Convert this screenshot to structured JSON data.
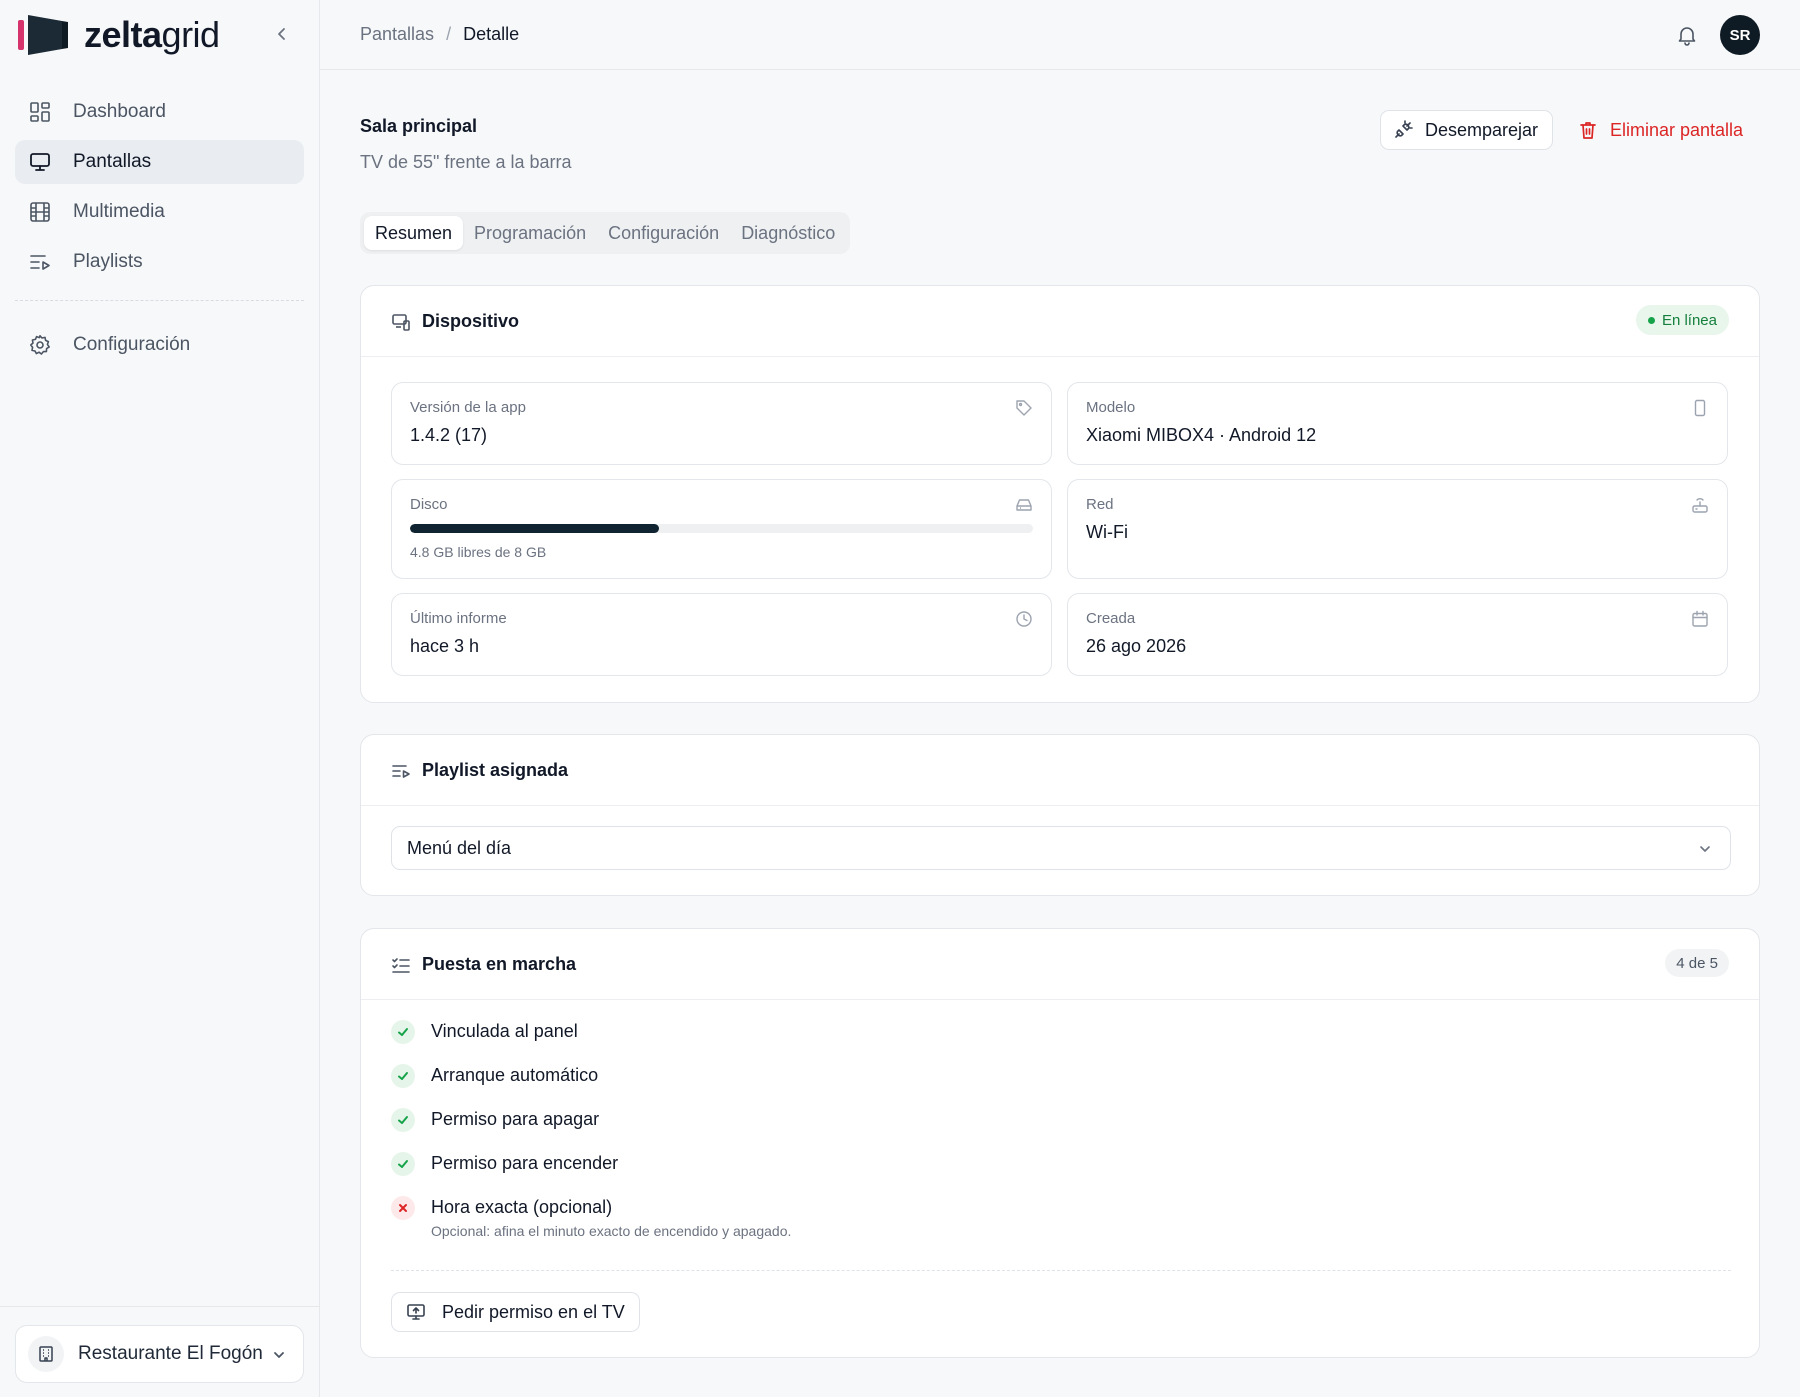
{
  "brand": {
    "name_bold": "zelta",
    "name_light": "grid",
    "accent_color": "#d6336c",
    "logo_color": "#1b2a35"
  },
  "sidebar": {
    "items": [
      {
        "label": "Dashboard",
        "icon": "dashboard-icon"
      },
      {
        "label": "Pantallas",
        "icon": "monitor-icon",
        "active": true
      },
      {
        "label": "Multimedia",
        "icon": "film-icon"
      },
      {
        "label": "Playlists",
        "icon": "playlist-icon"
      }
    ],
    "settings_label": "Configuración",
    "org_name": "Restaurante El Fogón"
  },
  "header": {
    "breadcrumb_parent": "Pantallas",
    "breadcrumb_separator": "/",
    "breadcrumb_current": "Detalle",
    "avatar_initials": "SR"
  },
  "screen": {
    "name": "Sala principal",
    "description": "TV de 55\" frente a la barra",
    "unpair_label": "Desemparejar",
    "delete_label": "Eliminar pantalla"
  },
  "tabs": [
    "Resumen",
    "Programación",
    "Configuración",
    "Diagnóstico"
  ],
  "device": {
    "title": "Dispositivo",
    "status": "En línea",
    "status_color": "#16a34a",
    "app_version_label": "Versión de la app",
    "app_version": "1.4.2 (17)",
    "model_label": "Modelo",
    "model": "Xiaomi MIBOX4 · Android 12",
    "disk_label": "Disco",
    "disk_used_fraction": 0.4,
    "disk_caption": "4.8 GB libres de 8 GB",
    "network_label": "Red",
    "network": "Wi-Fi",
    "last_report_label": "Último informe",
    "last_report": "hace 3 h",
    "created_label": "Creada",
    "created": "26 ago 2026"
  },
  "playlist": {
    "title": "Playlist asignada",
    "selected": "Menú del día"
  },
  "setup": {
    "title": "Puesta en marcha",
    "progress": "4 de 5",
    "items": [
      {
        "label": "Vinculada al panel",
        "done": true
      },
      {
        "label": "Arranque automático",
        "done": true
      },
      {
        "label": "Permiso para apagar",
        "done": true
      },
      {
        "label": "Permiso para encender",
        "done": true
      },
      {
        "label": "Hora exacta (opcional)",
        "done": false,
        "hint": "Opcional: afina el minuto exacto de encendido y apagado."
      }
    ],
    "request_label": "Pedir permiso en el TV"
  }
}
